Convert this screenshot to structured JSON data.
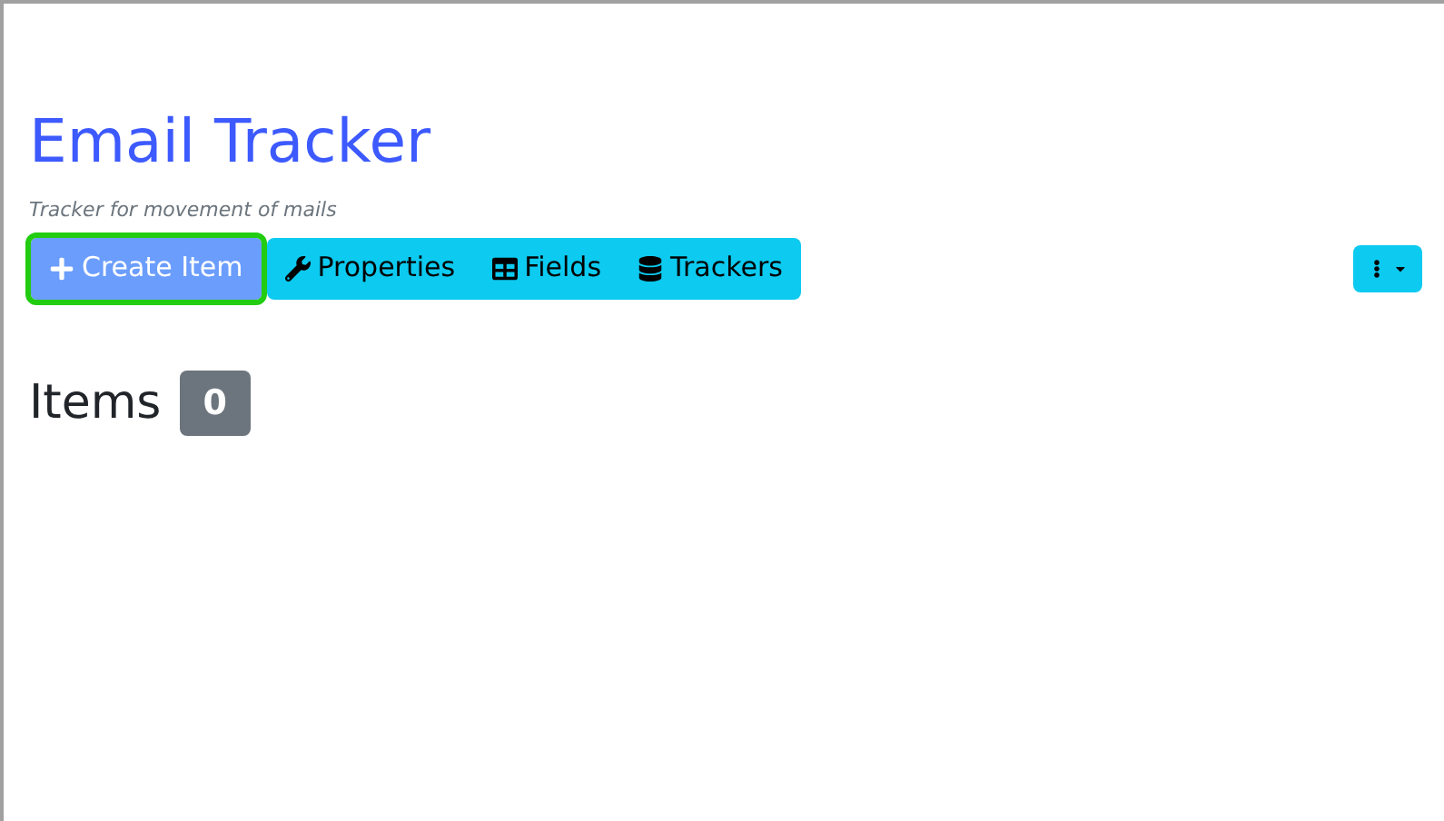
{
  "header": {
    "title": "Email Tracker",
    "subtitle": "Tracker for movement of mails"
  },
  "toolbar": [
    {
      "label": "Create Item",
      "kind": "primary",
      "focused": true
    },
    {
      "label": "Properties",
      "kind": "info",
      "focused": false
    },
    {
      "label": "Fields",
      "kind": "info",
      "focused": false
    },
    {
      "label": "Trackers",
      "kind": "info",
      "focused": false
    }
  ],
  "section": {
    "title": "Items",
    "count": "0"
  }
}
